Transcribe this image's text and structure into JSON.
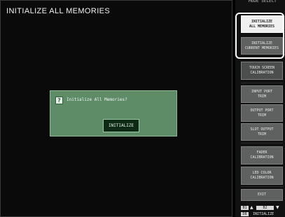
{
  "header": {
    "title": "INITIALIZE ALL MEMORIES"
  },
  "dialog": {
    "icon_glyph": "?",
    "message": "Initialize All Memories?",
    "confirm_label": "INITIALIZE"
  },
  "side_panel": {
    "title": "MODE SELECT",
    "items": [
      {
        "label": "INITIALIZE\nALL MEMORIES",
        "selected": true
      },
      {
        "label": "INITIALIZE\nCURRENT MEMORIES",
        "selected": false
      },
      {
        "label": "TOUCH SCREEN\nCALIBRATION",
        "selected": false
      },
      {
        "label": "INPUT PORT\nTRIM",
        "selected": false
      },
      {
        "label": "OUTPUT PORT\nTRIM",
        "selected": false
      },
      {
        "label": "SLOT OUTPUT\nTRIM",
        "selected": false
      },
      {
        "label": "FADER\nCALIBRATION",
        "selected": false
      },
      {
        "label": "LED COLOR\nCALIBRATION",
        "selected": false
      },
      {
        "label": "EXIT",
        "selected": false
      }
    ]
  },
  "status": {
    "chip_1": "B1",
    "chip_2": "B2",
    "chip_3": "D8",
    "mode_text": "INITIALIZE"
  }
}
